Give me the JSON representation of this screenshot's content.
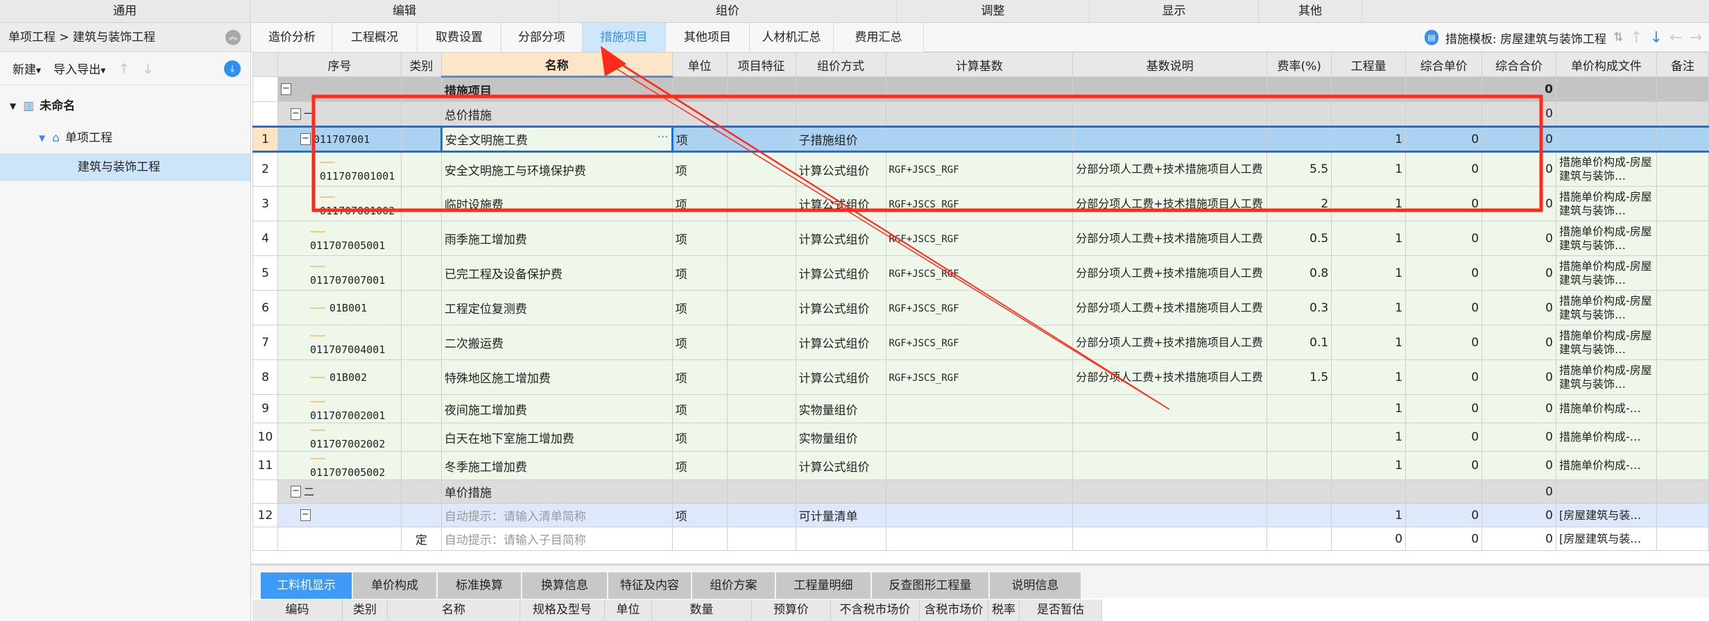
{
  "menubar": [
    "通用",
    "编辑",
    "组价",
    "调整",
    "显示",
    "其他"
  ],
  "left": {
    "breadcrumb": "单项工程 > 建筑与装饰工程",
    "toolbar": {
      "new": "新建",
      "import_export": "导入导出"
    },
    "tree": [
      {
        "label": "未命名",
        "icon": "building-icon"
      },
      {
        "label": "单项工程",
        "icon": "house-icon"
      },
      {
        "label": "建筑与装饰工程"
      }
    ]
  },
  "tabs": [
    "造价分析",
    "工程概况",
    "取费设置",
    "分部分项",
    "措施项目",
    "其他项目",
    "人材机汇总",
    "费用汇总"
  ],
  "active_tab": "措施项目",
  "template": {
    "label": "措施模板: 房屋建筑与装饰工程"
  },
  "columns": [
    "",
    "序号",
    "类别",
    "名称",
    "单位",
    "项目特征",
    "组价方式",
    "计算基数",
    "基数说明",
    "费率(%)",
    "工程量",
    "综合单价",
    "综合合价",
    "单价构成文件",
    "备注"
  ],
  "rows": [
    {
      "kind": "g0",
      "idx": "",
      "code": "",
      "type": "",
      "name": "措施项目",
      "unit": "",
      "feature": "",
      "method": "",
      "base": "",
      "desc": "",
      "rate": "",
      "qty": "",
      "price": "",
      "total": "0",
      "file": ""
    },
    {
      "kind": "g1",
      "idx": "",
      "code": "一",
      "type": "",
      "name": "总价措施",
      "unit": "",
      "feature": "",
      "method": "",
      "base": "",
      "desc": "",
      "rate": "",
      "qty": "",
      "price": "",
      "total": "0",
      "file": ""
    },
    {
      "kind": "sel",
      "idx": "1",
      "code": "011707001",
      "type": "",
      "name": "安全文明施工费",
      "unit": "项",
      "feature": "",
      "method": "子措施组价",
      "base": "",
      "desc": "",
      "rate": "",
      "qty": "1",
      "price": "0",
      "total": "0",
      "file": ""
    },
    {
      "kind": "green",
      "idx": "2",
      "code": "011707001001",
      "type": "",
      "name": "安全文明施工与环境保护费",
      "unit": "项",
      "feature": "",
      "method": "计算公式组价",
      "base": "RGF+JSCS_RGF",
      "desc": "分部分项人工费+技术措施项目人工费",
      "rate": "5.5",
      "qty": "1",
      "price": "0",
      "total": "0",
      "file": "措施单价构成-房屋建筑与装饰…"
    },
    {
      "kind": "green",
      "idx": "3",
      "code": "011707001002",
      "type": "",
      "name": "临时设施费",
      "unit": "项",
      "feature": "",
      "method": "计算公式组价",
      "base": "RGF+JSCS_RGF",
      "desc": "分部分项人工费+技术措施项目人工费",
      "rate": "2",
      "qty": "1",
      "price": "0",
      "total": "0",
      "file": "措施单价构成-房屋建筑与装饰…"
    },
    {
      "kind": "green",
      "idx": "4",
      "code": "011707005001",
      "type": "",
      "name": "雨季施工增加费",
      "unit": "项",
      "feature": "",
      "method": "计算公式组价",
      "base": "RGF+JSCS_RGF",
      "desc": "分部分项人工费+技术措施项目人工费",
      "rate": "0.5",
      "qty": "1",
      "price": "0",
      "total": "0",
      "file": "措施单价构成-房屋建筑与装饰…"
    },
    {
      "kind": "green",
      "idx": "5",
      "code": "011707007001",
      "type": "",
      "name": "已完工程及设备保护费",
      "unit": "项",
      "feature": "",
      "method": "计算公式组价",
      "base": "RGF+JSCS_RGF",
      "desc": "分部分项人工费+技术措施项目人工费",
      "rate": "0.8",
      "qty": "1",
      "price": "0",
      "total": "0",
      "file": "措施单价构成-房屋建筑与装饰…"
    },
    {
      "kind": "green",
      "idx": "6",
      "code": "01B001",
      "type": "",
      "name": "工程定位复测费",
      "unit": "项",
      "feature": "",
      "method": "计算公式组价",
      "base": "RGF+JSCS_RGF",
      "desc": "分部分项人工费+技术措施项目人工费",
      "rate": "0.3",
      "qty": "1",
      "price": "0",
      "total": "0",
      "file": "措施单价构成-房屋建筑与装饰…"
    },
    {
      "kind": "green",
      "idx": "7",
      "code": "011707004001",
      "type": "",
      "name": "二次搬运费",
      "unit": "项",
      "feature": "",
      "method": "计算公式组价",
      "base": "RGF+JSCS_RGF",
      "desc": "分部分项人工费+技术措施项目人工费",
      "rate": "0.1",
      "qty": "1",
      "price": "0",
      "total": "0",
      "file": "措施单价构成-房屋建筑与装饰…"
    },
    {
      "kind": "green",
      "idx": "8",
      "code": "01B002",
      "type": "",
      "name": "特殊地区施工增加费",
      "unit": "项",
      "feature": "",
      "method": "计算公式组价",
      "base": "RGF+JSCS_RGF",
      "desc": "分部分项人工费+技术措施项目人工费",
      "rate": "1.5",
      "qty": "1",
      "price": "0",
      "total": "0",
      "file": "措施单价构成-房屋建筑与装饰…"
    },
    {
      "kind": "green",
      "idx": "9",
      "code": "011707002001",
      "type": "",
      "name": "夜间施工增加费",
      "unit": "项",
      "feature": "",
      "method": "实物量组价",
      "base": "",
      "desc": "",
      "rate": "",
      "qty": "1",
      "price": "0",
      "total": "0",
      "file": "措施单价构成-…"
    },
    {
      "kind": "green",
      "idx": "10",
      "code": "011707002002",
      "type": "",
      "name": "白天在地下室施工增加费",
      "unit": "项",
      "feature": "",
      "method": "实物量组价",
      "base": "",
      "desc": "",
      "rate": "",
      "qty": "1",
      "price": "0",
      "total": "0",
      "file": "措施单价构成-…"
    },
    {
      "kind": "green",
      "idx": "11",
      "code": "011707005002",
      "type": "",
      "name": "冬季施工增加费",
      "unit": "项",
      "feature": "",
      "method": "计算公式组价",
      "base": "",
      "desc": "",
      "rate": "",
      "qty": "1",
      "price": "0",
      "total": "0",
      "file": "措施单价构成-…"
    },
    {
      "kind": "g1",
      "idx": "",
      "code": "二",
      "type": "",
      "name": "单价措施",
      "unit": "",
      "feature": "",
      "method": "",
      "base": "",
      "desc": "",
      "rate": "",
      "qty": "",
      "price": "",
      "total": "0",
      "file": ""
    },
    {
      "kind": "blue",
      "idx": "12",
      "code": "",
      "type": "",
      "name": "自动提示：请输入清单简称",
      "placeholder": true,
      "unit": "项",
      "feature": "",
      "method": "可计量清单",
      "base": "",
      "desc": "",
      "rate": "",
      "qty": "1",
      "price": "0",
      "total": "0",
      "file": "[房屋建筑与装…"
    },
    {
      "kind": "white",
      "idx": "",
      "code": "",
      "type": "定",
      "name": "自动提示：请输入子目简称",
      "placeholder": true,
      "unit": "",
      "feature": "",
      "method": "",
      "base": "",
      "desc": "",
      "rate": "",
      "qty": "0",
      "price": "0",
      "total": "0",
      "file": "[房屋建筑与装…"
    }
  ],
  "bottom_tabs": [
    "工料机显示",
    "单价构成",
    "标准换算",
    "换算信息",
    "特征及内容",
    "组价方案",
    "工程量明细",
    "反查图形工程量",
    "说明信息"
  ],
  "bottom_columns": [
    "编码",
    "类别",
    "名称",
    "规格及型号",
    "单位",
    "数量",
    "预算价",
    "不含税市场价",
    "含税市场价",
    "税率",
    "是否暂估"
  ],
  "colors": {
    "accent": "#3d9af5",
    "selection": "#acd2f2",
    "annotation": "#ff2a1a"
  }
}
